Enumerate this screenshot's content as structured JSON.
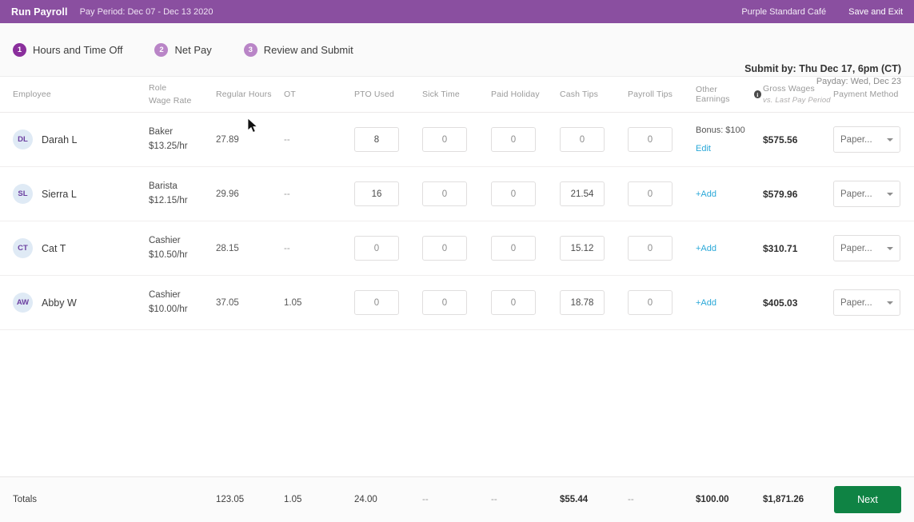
{
  "topbar": {
    "title": "Run Payroll",
    "pay_period": "Pay Period: Dec 07 - Dec 13 2020",
    "company": "Purple Standard Café",
    "save_and_exit": "Save and Exit",
    "bg_color": "#8a4fa0"
  },
  "steps": [
    {
      "num": "1",
      "label": "Hours and Time Off",
      "active": true
    },
    {
      "num": "2",
      "label": "Net Pay",
      "active": false
    },
    {
      "num": "3",
      "label": "Review and Submit",
      "active": false
    }
  ],
  "submit": {
    "deadline": "Submit by: Thu Dec 17, 6pm (CT)",
    "payday": "Payday: Wed, Dec 23"
  },
  "columns": {
    "employee": "Employee",
    "role_line1": "Role",
    "role_line2": "Wage Rate",
    "regular_hours": "Regular Hours",
    "ot": "OT",
    "pto_used": "PTO Used",
    "sick_time": "Sick Time",
    "paid_holiday": "Paid Holiday",
    "cash_tips": "Cash Tips",
    "payroll_tips": "Payroll Tips",
    "other_earnings": "Other Earnings",
    "other_earnings_icon": "info-icon",
    "gross_wages": "Gross Wages",
    "gross_wages_sub": "vs. Last Pay Period",
    "payment_method": "Payment Method"
  },
  "rows": [
    {
      "initials": "DL",
      "name": "Darah L",
      "role": "Baker",
      "wage": "$13.25/hr",
      "regular_hours": "27.89",
      "ot": "--",
      "pto_used": "8",
      "sick_time": "0",
      "paid_holiday": "0",
      "cash_tips": "0",
      "payroll_tips": "0",
      "other_earnings": "Bonus: $100",
      "other_earnings_link": "Edit",
      "gross_wages": "$575.56",
      "payment_method": "Paper..."
    },
    {
      "initials": "SL",
      "name": "Sierra L",
      "role": "Barista",
      "wage": "$12.15/hr",
      "regular_hours": "29.96",
      "ot": "--",
      "pto_used": "16",
      "sick_time": "0",
      "paid_holiday": "0",
      "cash_tips": "21.54",
      "payroll_tips": "0",
      "other_earnings": "",
      "other_earnings_link": "+Add",
      "gross_wages": "$579.96",
      "payment_method": "Paper..."
    },
    {
      "initials": "CT",
      "name": "Cat T",
      "role": "Cashier",
      "wage": "$10.50/hr",
      "regular_hours": "28.15",
      "ot": "--",
      "pto_used": "0",
      "sick_time": "0",
      "paid_holiday": "0",
      "cash_tips": "15.12",
      "payroll_tips": "0",
      "other_earnings": "",
      "other_earnings_link": "+Add",
      "gross_wages": "$310.71",
      "payment_method": "Paper..."
    },
    {
      "initials": "AW",
      "name": "Abby W",
      "role": "Cashier",
      "wage": "$10.00/hr",
      "regular_hours": "37.05",
      "ot": "1.05",
      "pto_used": "0",
      "sick_time": "0",
      "paid_holiday": "0",
      "cash_tips": "18.78",
      "payroll_tips": "0",
      "other_earnings": "",
      "other_earnings_link": "+Add",
      "gross_wages": "$405.03",
      "payment_method": "Paper..."
    }
  ],
  "totals": {
    "label": "Totals",
    "regular_hours": "123.05",
    "ot": "1.05",
    "pto_used": "24.00",
    "sick_time": "--",
    "paid_holiday": "--",
    "cash_tips": "$55.44",
    "payroll_tips": "--",
    "other_earnings": "$100.00",
    "gross_wages": "$1,871.26",
    "next_button": "Next",
    "next_color": "#0f8344"
  }
}
